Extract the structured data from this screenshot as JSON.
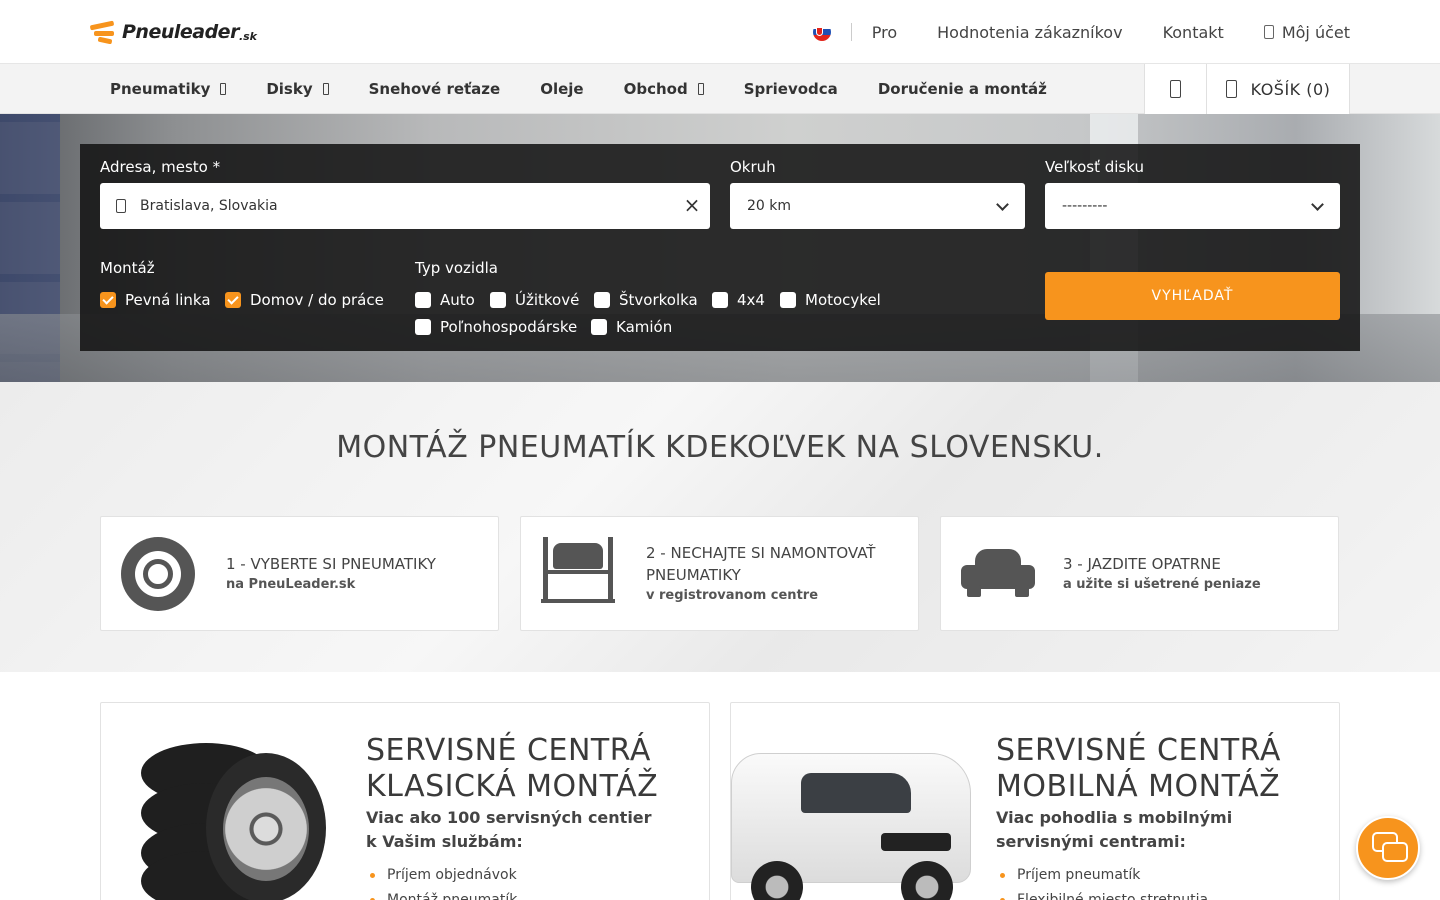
{
  "header": {
    "logo_name": "Pneuleader",
    "logo_tld": ".sk",
    "links": [
      "Pro",
      "Hodnotenia zákazníkov",
      "Kontakt"
    ],
    "account": "Môj účet"
  },
  "nav": {
    "items": [
      {
        "label": "Pneumatiky",
        "has_dropdown": true
      },
      {
        "label": "Disky",
        "has_dropdown": true
      },
      {
        "label": "Snehové reťaze",
        "has_dropdown": false
      },
      {
        "label": "Oleje",
        "has_dropdown": false
      },
      {
        "label": "Obchod",
        "has_dropdown": true
      },
      {
        "label": "Sprievodca",
        "has_dropdown": false
      },
      {
        "label": "Doručenie a montáž",
        "has_dropdown": false
      }
    ],
    "cart": "KOŠÍK (0)"
  },
  "search": {
    "address_label": "Adresa, mesto *",
    "address_value": "Bratislava, Slovakia",
    "radius_label": "Okruh",
    "radius_value": "20 km",
    "rim_label": "Veľkosť disku",
    "rim_value": "---------",
    "montage_label": "Montáž",
    "montage_options": [
      {
        "label": "Pevná linka",
        "checked": true
      },
      {
        "label": "Domov / do práce",
        "checked": true
      }
    ],
    "vehicle_label": "Typ vozidla",
    "vehicle_options": [
      {
        "label": "Auto",
        "checked": false
      },
      {
        "label": "Úžitkové",
        "checked": false
      },
      {
        "label": "Štvorkolka",
        "checked": false
      },
      {
        "label": "4x4",
        "checked": false
      },
      {
        "label": "Motocykel",
        "checked": false
      },
      {
        "label": "Poľnohospodárske",
        "checked": false
      },
      {
        "label": "Kamión",
        "checked": false
      }
    ],
    "submit": "VYHĽADAŤ"
  },
  "steps": {
    "title": "MONTÁŽ PNEUMATÍK KDEKOĽVEK NA SLOVENSKU.",
    "items": [
      {
        "title": "1 - VYBERTE SI PNEUMATIKY",
        "subtitle": "na PneuLeader.sk",
        "icon": "tire-icon"
      },
      {
        "title": "2 - NECHAJTE SI NAMONTOVAŤ PNEUMATIKY",
        "subtitle": "v registrovanom centre",
        "icon": "car-lift-icon"
      },
      {
        "title": "3 - JAZDITE OPATRNE",
        "subtitle": "a užite si ušetrené peniaze",
        "icon": "car-icon"
      }
    ]
  },
  "services": [
    {
      "title": "SERVISNÉ CENTRÁ KLASICKÁ MONTÁŽ",
      "lead": "Viac ako 100 servisných centier k Vašim službám:",
      "bullets": [
        "Príjem objednávok",
        "Montáž pneumatík"
      ]
    },
    {
      "title": "SERVISNÉ CENTRÁ MOBILNÁ MONTÁŽ",
      "lead": "Viac pohodlia s mobilnými servisnými centrami:",
      "bullets": [
        "Príjem pneumatík",
        "Flexibilné miesto stretnutia"
      ]
    }
  ],
  "colors": {
    "accent": "#f7941d",
    "panel": "#141414",
    "nav_bg": "#f3f3f3"
  }
}
